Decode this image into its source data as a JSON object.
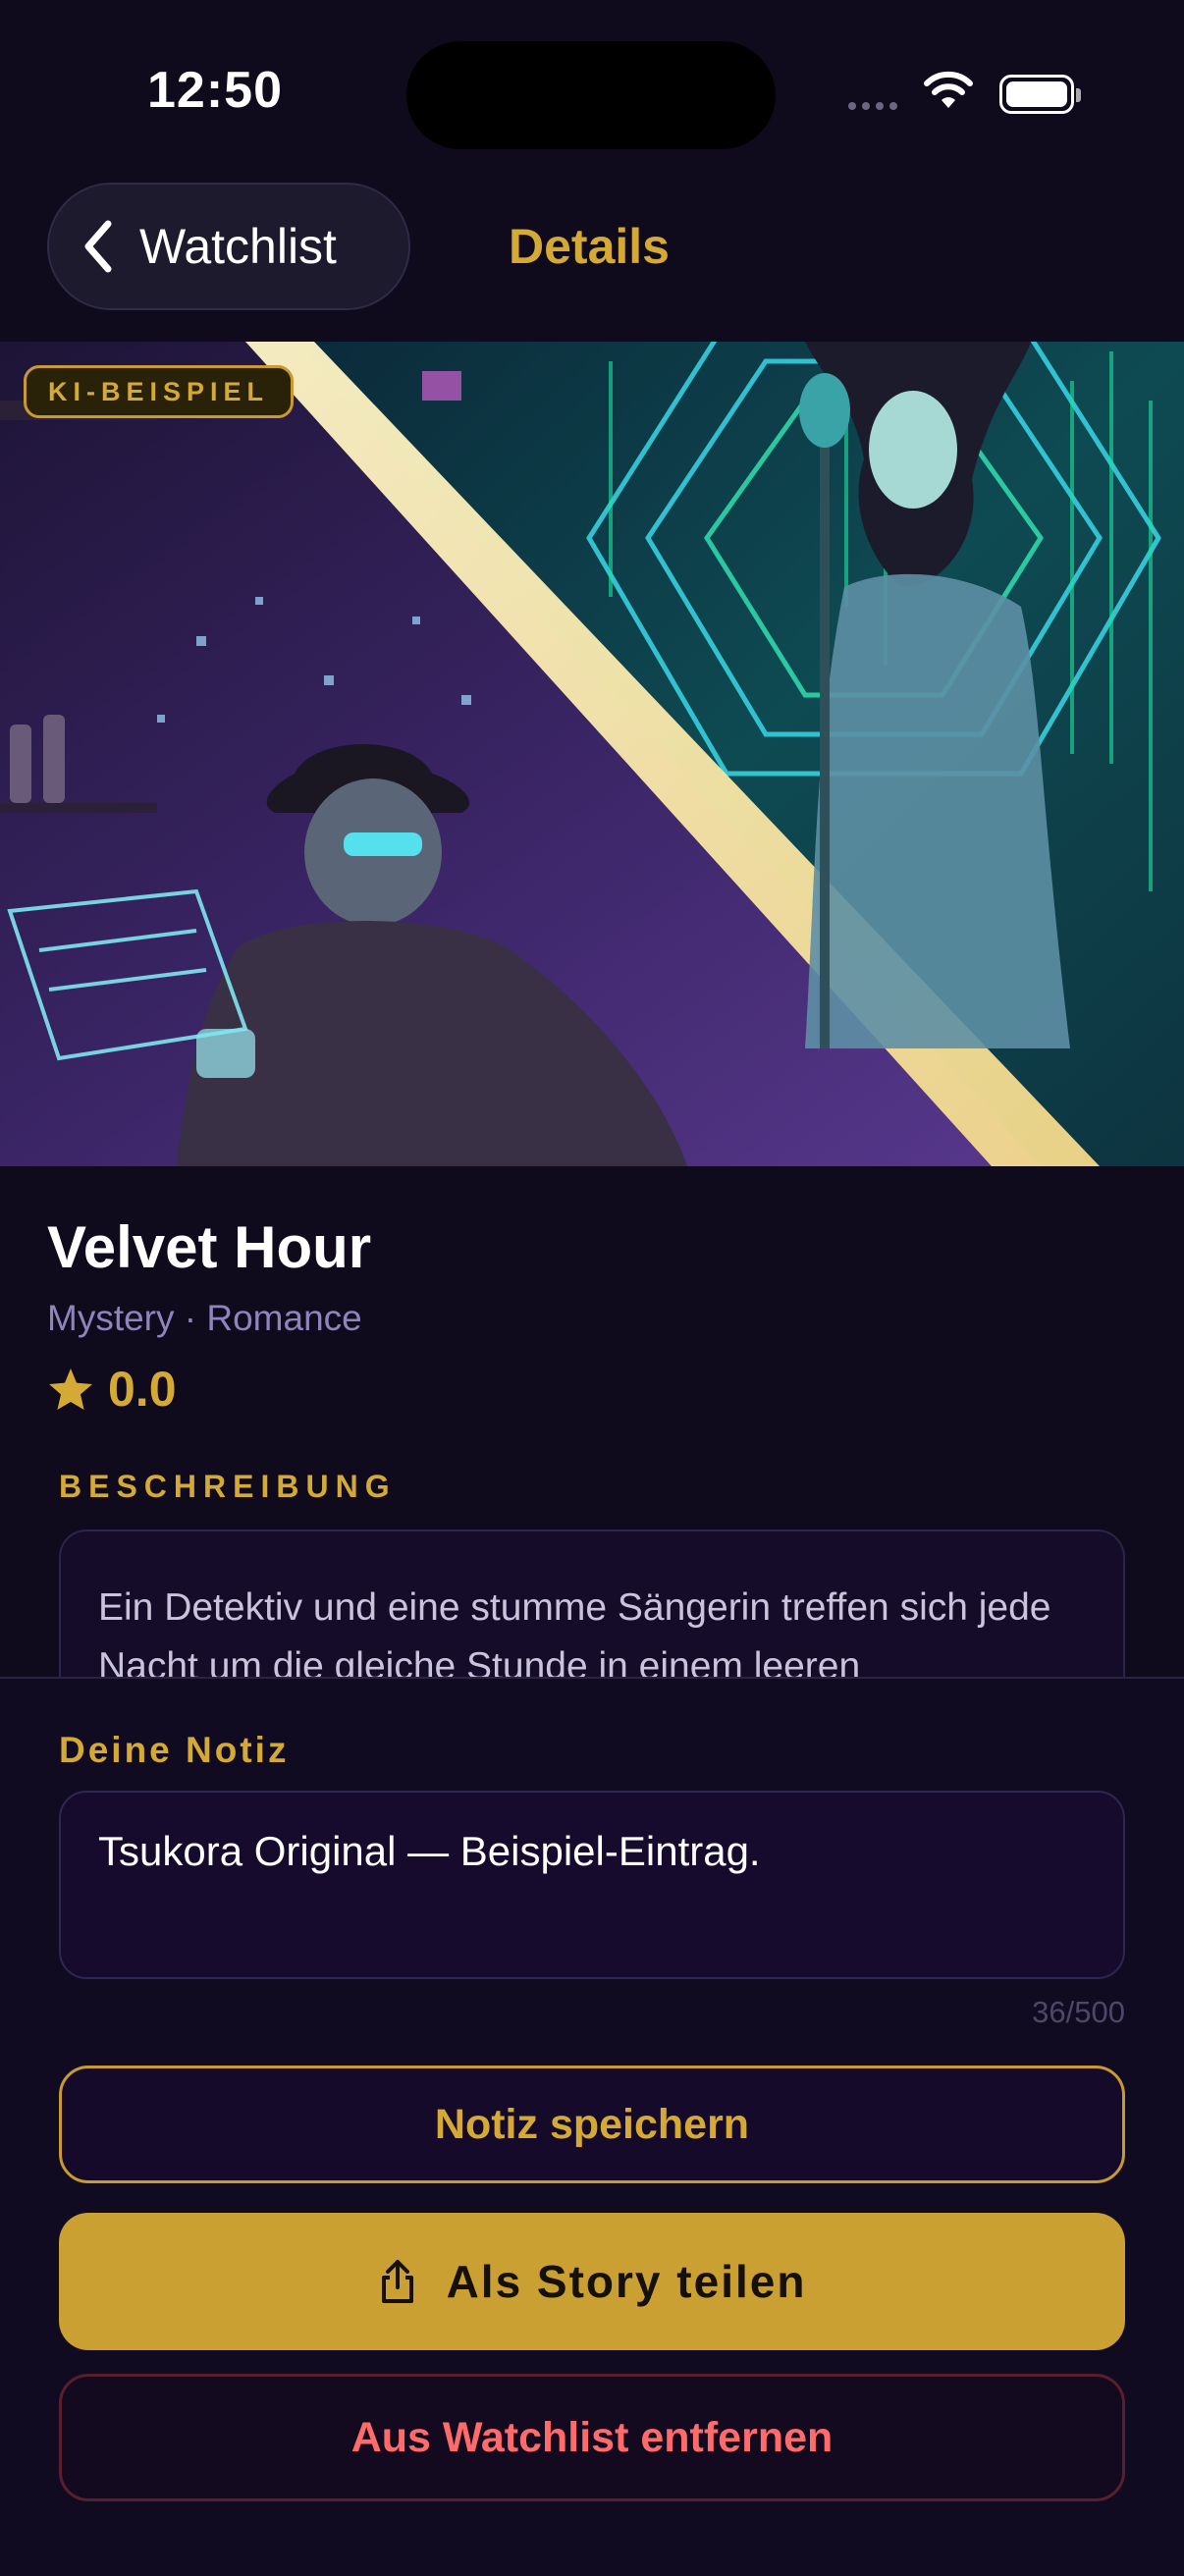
{
  "status_bar": {
    "time": "12:50"
  },
  "nav": {
    "back_label": "Watchlist",
    "title": "Details"
  },
  "hero": {
    "badge": "KI-BEISPIEL"
  },
  "item": {
    "title": "Velvet Hour",
    "genres": "Mystery · Romance",
    "rating": "0.0",
    "description_label": "BESCHREIBUNG",
    "description": "Ein Detektiv und eine stumme Sängerin treffen sich jede Nacht um die gleiche Stunde in einem leeren"
  },
  "note": {
    "label": "Deine Notiz",
    "value": "Tsukora Original — Beispiel-Eintrag.",
    "counter": "36/500"
  },
  "actions": {
    "save": "Notiz speichern",
    "share": "Als Story teilen",
    "remove": "Aus Watchlist entfernen"
  },
  "colors": {
    "background": "#0f0a1c",
    "accent_gold": "#d4a934",
    "muted_purple": "#8f84bb",
    "danger": "#ff6b6b"
  }
}
